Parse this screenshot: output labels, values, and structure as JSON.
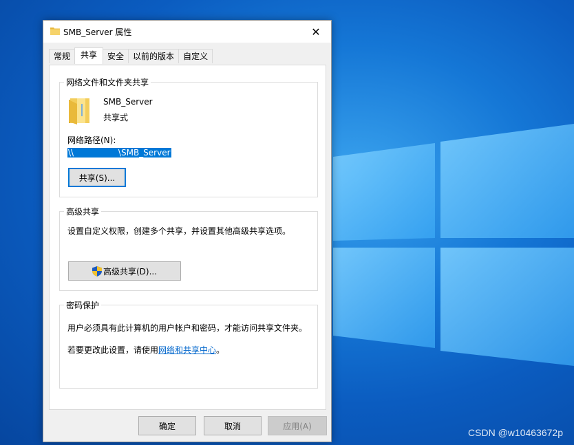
{
  "dialog": {
    "title": "SMB_Server 属性",
    "close_glyph": "✕",
    "tabs": [
      "常规",
      "共享",
      "安全",
      "以前的版本",
      "自定义"
    ],
    "active_tab": 1
  },
  "network_sharing": {
    "group_title": "网络文件和文件夹共享",
    "folder_name": "SMB_Server",
    "share_state": "共享式",
    "path_label": "网络路径(N):",
    "path_value": "\\\\                 \\SMB_Server",
    "share_button": "共享(S)..."
  },
  "advanced_sharing": {
    "group_title": "高级共享",
    "description": "设置自定义权限，创建多个共享，并设置其他高级共享选项。",
    "button": "高级共享(D)..."
  },
  "password_protection": {
    "group_title": "密码保护",
    "line1": "用户必须具有此计算机的用户帐户和密码，才能访问共享文件夹。",
    "line2_prefix": "若要更改此设置，请使用",
    "line2_link": "网络和共享中心",
    "line2_suffix": "。"
  },
  "footer": {
    "ok": "确定",
    "cancel": "取消",
    "apply": "应用(A)"
  },
  "watermark": "CSDN @w10463672p",
  "colors": {
    "accent": "#0078d7",
    "link": "#0066cc",
    "desktop": "#0b5cc0"
  }
}
